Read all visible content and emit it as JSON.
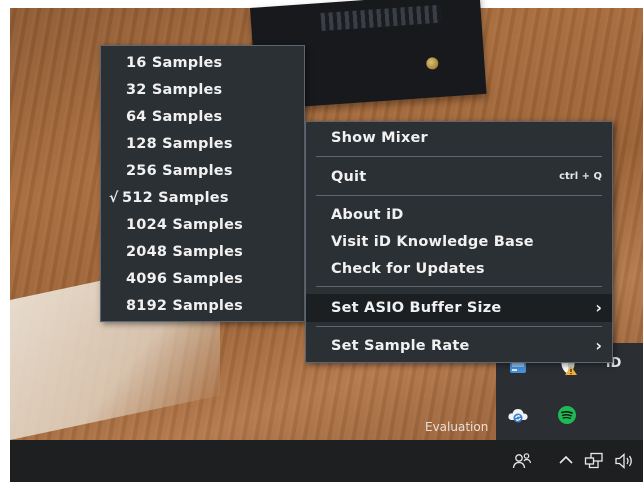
{
  "colors": {
    "menu_bg": "#2b3034",
    "menu_border": "#5d6670",
    "menu_text": "#f1f1f1",
    "menu_highlight": "#1b1f22",
    "taskbar_bg": "#1d1f21",
    "spotify_green": "#1db954"
  },
  "main_menu": {
    "show_mixer": "Show Mixer",
    "quit": "Quit",
    "quit_shortcut": "ctrl + Q",
    "about": "About iD",
    "knowledge_base": "Visit iD Knowledge Base",
    "check_updates": "Check for Updates",
    "asio_buffer": "Set ASIO Buffer Size",
    "sample_rate": "Set Sample Rate",
    "chevron": "›"
  },
  "buffer_menu": {
    "check_glyph": "√",
    "selected": "512 Samples",
    "hovered": "2048 Samples",
    "items": [
      "16 Samples",
      "32 Samples",
      "64 Samples",
      "128 Samples",
      "256 Samples",
      "512 Samples",
      "1024 Samples",
      "2048 Samples",
      "4096 Samples",
      "8192 Samples"
    ]
  },
  "tray": {
    "id_label": "iD",
    "icons": [
      "network-drive-icon",
      "security-shield-warning-icon",
      "cloud-sync-icon",
      "spotify-icon"
    ]
  },
  "desktop": {
    "watermark": "Evaluation"
  },
  "taskbar": {
    "icons": [
      "people-icon",
      "chevron-up-icon",
      "network-icon",
      "volume-icon"
    ]
  }
}
